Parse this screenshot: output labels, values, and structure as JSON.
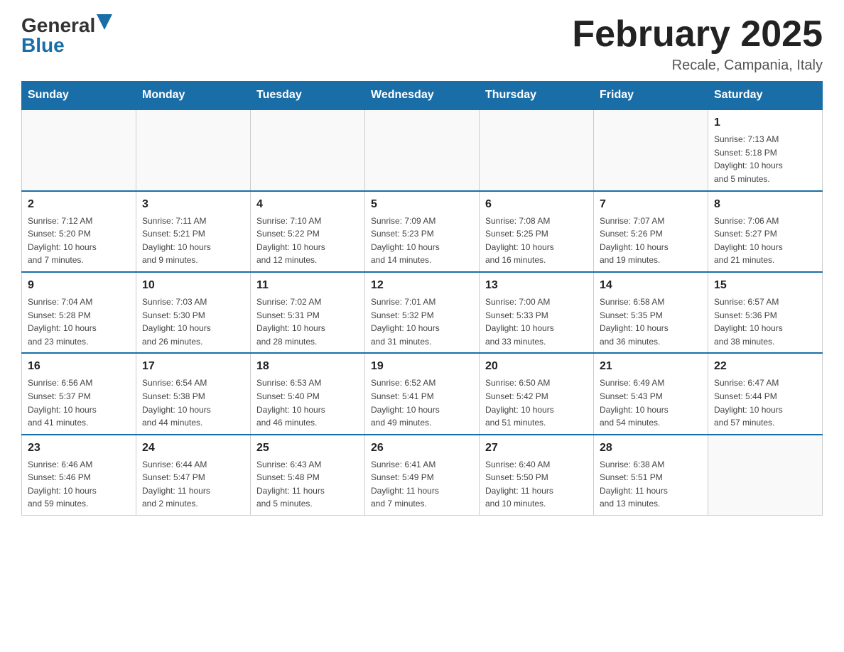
{
  "header": {
    "logo_general": "General",
    "logo_blue": "Blue",
    "month_title": "February 2025",
    "subtitle": "Recale, Campania, Italy"
  },
  "weekdays": [
    "Sunday",
    "Monday",
    "Tuesday",
    "Wednesday",
    "Thursday",
    "Friday",
    "Saturday"
  ],
  "weeks": [
    [
      {
        "day": "",
        "info": ""
      },
      {
        "day": "",
        "info": ""
      },
      {
        "day": "",
        "info": ""
      },
      {
        "day": "",
        "info": ""
      },
      {
        "day": "",
        "info": ""
      },
      {
        "day": "",
        "info": ""
      },
      {
        "day": "1",
        "info": "Sunrise: 7:13 AM\nSunset: 5:18 PM\nDaylight: 10 hours\nand 5 minutes."
      }
    ],
    [
      {
        "day": "2",
        "info": "Sunrise: 7:12 AM\nSunset: 5:20 PM\nDaylight: 10 hours\nand 7 minutes."
      },
      {
        "day": "3",
        "info": "Sunrise: 7:11 AM\nSunset: 5:21 PM\nDaylight: 10 hours\nand 9 minutes."
      },
      {
        "day": "4",
        "info": "Sunrise: 7:10 AM\nSunset: 5:22 PM\nDaylight: 10 hours\nand 12 minutes."
      },
      {
        "day": "5",
        "info": "Sunrise: 7:09 AM\nSunset: 5:23 PM\nDaylight: 10 hours\nand 14 minutes."
      },
      {
        "day": "6",
        "info": "Sunrise: 7:08 AM\nSunset: 5:25 PM\nDaylight: 10 hours\nand 16 minutes."
      },
      {
        "day": "7",
        "info": "Sunrise: 7:07 AM\nSunset: 5:26 PM\nDaylight: 10 hours\nand 19 minutes."
      },
      {
        "day": "8",
        "info": "Sunrise: 7:06 AM\nSunset: 5:27 PM\nDaylight: 10 hours\nand 21 minutes."
      }
    ],
    [
      {
        "day": "9",
        "info": "Sunrise: 7:04 AM\nSunset: 5:28 PM\nDaylight: 10 hours\nand 23 minutes."
      },
      {
        "day": "10",
        "info": "Sunrise: 7:03 AM\nSunset: 5:30 PM\nDaylight: 10 hours\nand 26 minutes."
      },
      {
        "day": "11",
        "info": "Sunrise: 7:02 AM\nSunset: 5:31 PM\nDaylight: 10 hours\nand 28 minutes."
      },
      {
        "day": "12",
        "info": "Sunrise: 7:01 AM\nSunset: 5:32 PM\nDaylight: 10 hours\nand 31 minutes."
      },
      {
        "day": "13",
        "info": "Sunrise: 7:00 AM\nSunset: 5:33 PM\nDaylight: 10 hours\nand 33 minutes."
      },
      {
        "day": "14",
        "info": "Sunrise: 6:58 AM\nSunset: 5:35 PM\nDaylight: 10 hours\nand 36 minutes."
      },
      {
        "day": "15",
        "info": "Sunrise: 6:57 AM\nSunset: 5:36 PM\nDaylight: 10 hours\nand 38 minutes."
      }
    ],
    [
      {
        "day": "16",
        "info": "Sunrise: 6:56 AM\nSunset: 5:37 PM\nDaylight: 10 hours\nand 41 minutes."
      },
      {
        "day": "17",
        "info": "Sunrise: 6:54 AM\nSunset: 5:38 PM\nDaylight: 10 hours\nand 44 minutes."
      },
      {
        "day": "18",
        "info": "Sunrise: 6:53 AM\nSunset: 5:40 PM\nDaylight: 10 hours\nand 46 minutes."
      },
      {
        "day": "19",
        "info": "Sunrise: 6:52 AM\nSunset: 5:41 PM\nDaylight: 10 hours\nand 49 minutes."
      },
      {
        "day": "20",
        "info": "Sunrise: 6:50 AM\nSunset: 5:42 PM\nDaylight: 10 hours\nand 51 minutes."
      },
      {
        "day": "21",
        "info": "Sunrise: 6:49 AM\nSunset: 5:43 PM\nDaylight: 10 hours\nand 54 minutes."
      },
      {
        "day": "22",
        "info": "Sunrise: 6:47 AM\nSunset: 5:44 PM\nDaylight: 10 hours\nand 57 minutes."
      }
    ],
    [
      {
        "day": "23",
        "info": "Sunrise: 6:46 AM\nSunset: 5:46 PM\nDaylight: 10 hours\nand 59 minutes."
      },
      {
        "day": "24",
        "info": "Sunrise: 6:44 AM\nSunset: 5:47 PM\nDaylight: 11 hours\nand 2 minutes."
      },
      {
        "day": "25",
        "info": "Sunrise: 6:43 AM\nSunset: 5:48 PM\nDaylight: 11 hours\nand 5 minutes."
      },
      {
        "day": "26",
        "info": "Sunrise: 6:41 AM\nSunset: 5:49 PM\nDaylight: 11 hours\nand 7 minutes."
      },
      {
        "day": "27",
        "info": "Sunrise: 6:40 AM\nSunset: 5:50 PM\nDaylight: 11 hours\nand 10 minutes."
      },
      {
        "day": "28",
        "info": "Sunrise: 6:38 AM\nSunset: 5:51 PM\nDaylight: 11 hours\nand 13 minutes."
      },
      {
        "day": "",
        "info": ""
      }
    ]
  ]
}
